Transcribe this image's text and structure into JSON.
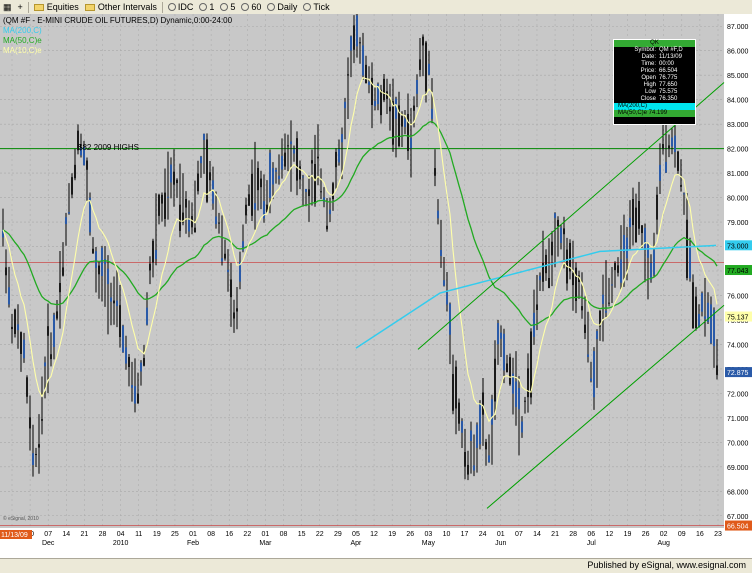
{
  "toolbar": {
    "items": [
      {
        "label": "Equities",
        "icon": "folder-icon"
      },
      {
        "label": "Other Intervals",
        "icon": "folder-icon"
      },
      {
        "label": "IDC",
        "icon": "clock-icon"
      },
      {
        "label": "1"
      },
      {
        "label": "5"
      },
      {
        "label": "60"
      },
      {
        "label": "Daily"
      },
      {
        "label": "Tick"
      }
    ]
  },
  "chart": {
    "title": "(QM #F - E-MINI CRUDE OIL FUTURES,D) Dynamic,0:00-24:00",
    "legend": [
      "MA(200,C)",
      "MA(50,C)e",
      "MA(10,C)e"
    ],
    "annotation": "$82 2009 HIGHS",
    "copyright": "© eSignal, 2010",
    "date_flag": "11/13/09",
    "price_labels": {
      "ma200": "73.000",
      "ma50": "77.043",
      "ma10": "75.137",
      "last": "72.875",
      "low_line": "66.504"
    },
    "colors": {
      "background": "#c8c8c8",
      "grid": "#a8a8a8",
      "bars": "#000000",
      "ma200": "#33ccee",
      "ma50": "#22aa22",
      "ma10": "#ffffaa",
      "trendline": "#00a000",
      "horizontal_green": "#008800",
      "horizontal_red": "#cc3333"
    },
    "y_axis": {
      "min": 66.5,
      "max": 87.5,
      "ticks": [
        "67.000",
        "68.000",
        "69.000",
        "70.000",
        "71.000",
        "72.000",
        "73.000",
        "74.000",
        "75.000",
        "76.000",
        "77.000",
        "78.000",
        "79.000",
        "80.000",
        "81.000",
        "82.000",
        "83.000",
        "84.000",
        "85.000",
        "86.000",
        "87.000"
      ]
    },
    "x_axis": {
      "day_labels": [
        "23",
        "30",
        "07",
        "14",
        "21",
        "28",
        "04",
        "11",
        "19",
        "25",
        "01",
        "08",
        "16",
        "22",
        "01",
        "08",
        "15",
        "22",
        "29",
        "05",
        "12",
        "19",
        "26",
        "03",
        "10",
        "17",
        "24",
        "01",
        "07",
        "14",
        "21",
        "28",
        "06",
        "12",
        "19",
        "26",
        "02",
        "09",
        "16",
        "23"
      ],
      "month_labels": [
        "Dec",
        "2010",
        "Feb",
        "Mar",
        "Apr",
        "May",
        "Jun",
        "Jul",
        "Aug"
      ]
    }
  },
  "data_window": {
    "header": "QK",
    "rows": [
      {
        "k": "Symbol:",
        "v": "QM #F,D"
      },
      {
        "k": "Date:",
        "v": "11/13/09"
      },
      {
        "k": "Time:",
        "v": "00:00"
      },
      {
        "k": "Price:",
        "v": "66.504"
      },
      {
        "k": "Open",
        "v": "76.775"
      },
      {
        "k": "High",
        "v": "77.650"
      },
      {
        "k": "Low",
        "v": "75.575"
      },
      {
        "k": "Close",
        "v": "76.350"
      }
    ],
    "ma200": "MA(200,C)",
    "ma50": "MA(50,C)e 74.199"
  },
  "status_bar": {
    "text": "Published by eSignal, www.esignal.com"
  }
}
